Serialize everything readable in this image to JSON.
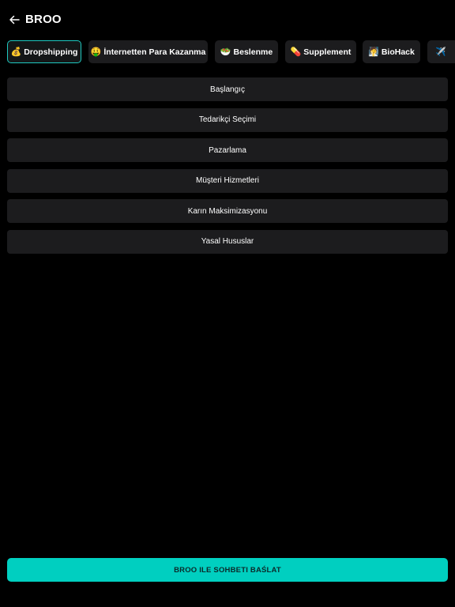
{
  "header": {
    "title": "BROO",
    "back_icon": "arrow-left-icon"
  },
  "chips": [
    {
      "emoji": "💰",
      "label": "Dropshipping",
      "active": true
    },
    {
      "emoji": "🤑",
      "label": "İnternetten Para Kazanma",
      "active": false
    },
    {
      "emoji": "🥗",
      "label": "Beslenme",
      "active": false
    },
    {
      "emoji": "💊",
      "label": "Supplement",
      "active": false
    },
    {
      "emoji": "🧖",
      "label": "BioHack",
      "active": false
    },
    {
      "emoji": "✈️",
      "label": "",
      "active": false
    }
  ],
  "topics": [
    {
      "label": "Başlangıç"
    },
    {
      "label": "Tedarikçi Seçimi"
    },
    {
      "label": "Pazarlama"
    },
    {
      "label": "Müşteri Hizmetleri"
    },
    {
      "label": "Karın Maksimizasyonu"
    },
    {
      "label": "Yasal Hususlar"
    }
  ],
  "cta": {
    "label": "BROO ILE SOHBETI BAŚLAT"
  },
  "colors": {
    "background": "#000000",
    "surface": "#1c1c1e",
    "accent": "#00cfc0",
    "active_border": "#1ec9c0"
  }
}
